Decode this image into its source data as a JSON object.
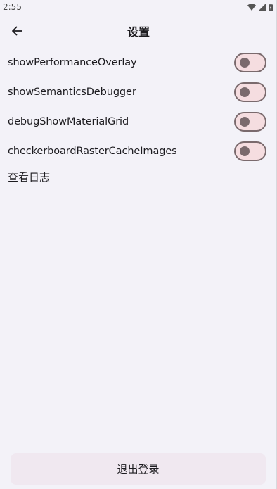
{
  "status_bar": {
    "time": "2:55",
    "icons": [
      "wifi-icon",
      "signal-icon",
      "battery-icon"
    ]
  },
  "app_bar": {
    "back_icon": "arrow-left-icon",
    "title": "设置"
  },
  "settings": {
    "toggles": [
      {
        "label": "showPerformanceOverlay",
        "on": false
      },
      {
        "label": "showSemanticsDebugger",
        "on": false
      },
      {
        "label": "debugShowMaterialGrid",
        "on": false
      },
      {
        "label": "checkerboardRasterCacheImages",
        "on": false
      }
    ],
    "view_log": "查看日志"
  },
  "logout": {
    "label": "退出登录"
  },
  "colors": {
    "background": "#f3f2f8",
    "switch_track": "#f5dde0",
    "switch_outline": "#7a6a6d",
    "logout_button": "#f0e8f0"
  }
}
